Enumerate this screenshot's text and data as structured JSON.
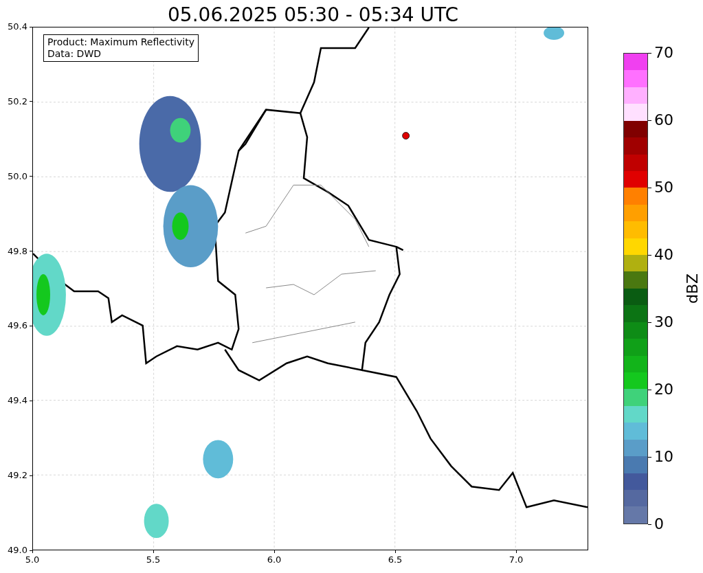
{
  "title": "05.06.2025 05:30 - 05:34 UTC",
  "map": {
    "legend": [
      "Product: Maximum Reflectivity",
      "Data: DWD"
    ],
    "x_ticks": [
      "5.0",
      "5.5",
      "6.0",
      "6.5",
      "7.0"
    ],
    "y_ticks": [
      "50.4",
      "50.2",
      "50.0",
      "49.8",
      "49.6",
      "49.4",
      "49.2",
      "49.0"
    ]
  },
  "colorbar": {
    "label": "dBZ",
    "ticks": [
      "70",
      "60",
      "50",
      "40",
      "30",
      "20",
      "10",
      "0"
    ],
    "segments": [
      {
        "color": "#f040f0"
      },
      {
        "color": "#ff70ff"
      },
      {
        "color": "#ffb0ff"
      },
      {
        "color": "#ffe0ff"
      },
      {
        "color": "#800000"
      },
      {
        "color": "#a00000"
      },
      {
        "color": "#c00000"
      },
      {
        "color": "#e00000"
      },
      {
        "color": "#ff8000"
      },
      {
        "color": "#ff9f00"
      },
      {
        "color": "#ffbc00"
      },
      {
        "color": "#ffd700"
      },
      {
        "color": "#b0b010"
      },
      {
        "color": "#4a7810"
      },
      {
        "color": "#0a5c12"
      },
      {
        "color": "#0c7414"
      },
      {
        "color": "#0e8c16"
      },
      {
        "color": "#10a018"
      },
      {
        "color": "#12b41a"
      },
      {
        "color": "#14c81e"
      },
      {
        "color": "#3fd27a"
      },
      {
        "color": "#62d8c8"
      },
      {
        "color": "#60bcd8"
      },
      {
        "color": "#5a9dc8"
      },
      {
        "color": "#4a7ab0"
      },
      {
        "color": "#43599c"
      },
      {
        "color": "#5569a0"
      },
      {
        "color": "#6578a8"
      }
    ]
  }
}
